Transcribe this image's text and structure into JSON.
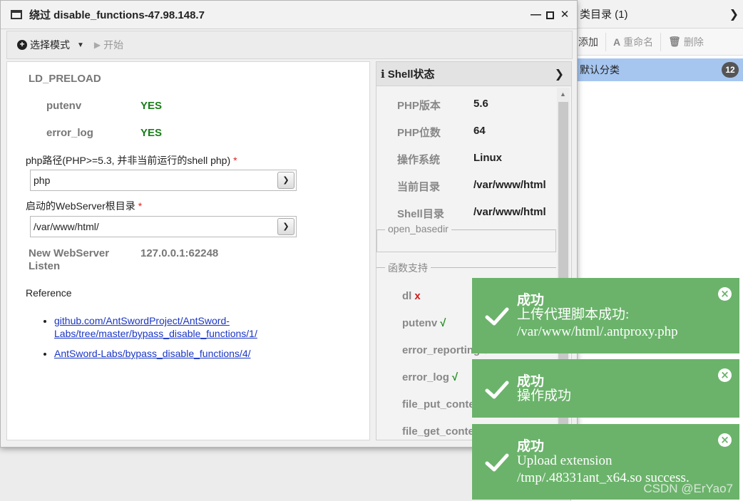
{
  "background_panel": {
    "header_title": "类目录 (1)",
    "toolbar": {
      "add_label": "添加",
      "rename_label": "重命名",
      "delete_label": "删除"
    },
    "items": [
      {
        "label": "默认分类",
        "count": "12"
      }
    ]
  },
  "window": {
    "title": "绕过 disable_functions-47.98.148.7",
    "toolbar": {
      "select_mode_label": "选择模式",
      "start_label": "开始"
    }
  },
  "form": {
    "section": "LD_PRELOAD",
    "checks": [
      {
        "name": "putenv",
        "value": "YES"
      },
      {
        "name": "error_log",
        "value": "YES"
      }
    ],
    "php_path_label": "php路径(PHP>=5.3, 并非当前运行的shell php)",
    "required_mark": "*",
    "php_path_value": "php",
    "webroot_label": "启动的WebServer根目录",
    "webroot_value": "/var/www/html/",
    "listen_label_line1": "New WebServer",
    "listen_label_line2": "Listen",
    "listen_value": "127.0.0.1:62248",
    "reference_title": "Reference",
    "references": [
      {
        "line1": "github.com/AntSwordProject/AntSword-",
        "line2": "Labs/tree/master/bypass_disable_functions/1/"
      },
      {
        "line1": "AntSword-Labs/bypass_disable_functions/4/",
        "line2": ""
      }
    ]
  },
  "shell_status": {
    "title": "Shell状态",
    "info": [
      {
        "key": "PHP版本",
        "value": "5.6"
      },
      {
        "key": "PHP位数",
        "value": "64"
      },
      {
        "key": "操作系统",
        "value": "Linux"
      },
      {
        "key": "当前目录",
        "value": "/var/www/html"
      },
      {
        "key": "Shell目录",
        "value": "/var/www/html"
      }
    ],
    "open_basedir_label": "open_basedir",
    "functions_label": "函数支持",
    "functions": [
      {
        "name": "dl",
        "mark": "x"
      },
      {
        "name": "putenv",
        "mark": "√"
      },
      {
        "name": "error_reporting",
        "mark": "√"
      },
      {
        "name": "error_log",
        "mark": "√"
      },
      {
        "name": "file_put_contents",
        "mark": "√"
      },
      {
        "name": "file_get_contents",
        "mark": "√"
      }
    ]
  },
  "toasts": [
    {
      "title": "成功",
      "line1": "上传代理脚本成功:",
      "line2": "/var/www/html/.antproxy.php"
    },
    {
      "title": "成功",
      "line1": "操作成功",
      "line2": ""
    },
    {
      "title": "成功",
      "line1": "Upload extension",
      "line2": "/tmp/.48331ant_x64.so success."
    }
  ],
  "watermark": "CSDN @ErYao7",
  "colors": {
    "toast_bg": "#6bb36b",
    "yes_green": "#1a7d1a",
    "link_blue": "#1a35c4",
    "selected_item": "#a6c6f0"
  }
}
